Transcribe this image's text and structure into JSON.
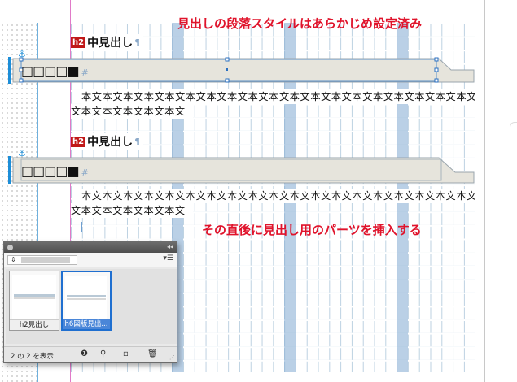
{
  "annotations": {
    "top": "見出しの段落スタイルはあらかじめ設定済み",
    "middle": "その直後に見出し用のパーツを挿入する"
  },
  "headings": [
    {
      "badge": "h2",
      "text": "中見出し",
      "mark": "¶"
    },
    {
      "badge": "h2",
      "text": "中見出し",
      "mark": "¶"
    }
  ],
  "parts": [
    {
      "text": "□□□□■",
      "mark": "#"
    },
    {
      "text": "□□□□■",
      "mark": "#"
    }
  ],
  "body": {
    "line1": "本文本文本文本文本文本文本文本文本文本文本文本文本文本文本文本文本文本文本文本文本文",
    "line2": "文本文本文本文本文本文"
  },
  "panel": {
    "dropdown_value": "",
    "items": [
      {
        "label": "h2見出し"
      },
      {
        "label": "h6図版見出..."
      }
    ],
    "count_text": "2 の 2 を表示",
    "icons": [
      "info-icon",
      "binoculars-icon",
      "new-item-icon",
      "trash-icon"
    ]
  },
  "colors": {
    "annotation": "#e0132b",
    "accent": "#1d8ed8",
    "badge": "#c01818"
  }
}
